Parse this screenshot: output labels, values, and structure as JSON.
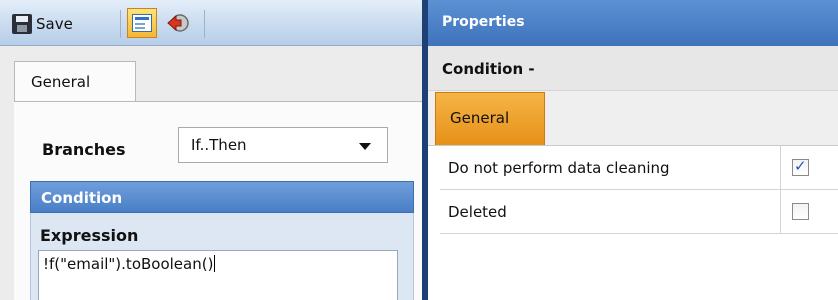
{
  "toolbar": {
    "save_label": "Save",
    "icons": [
      "floppy-disk-icon",
      "properties-icon",
      "back-arrow-icon"
    ]
  },
  "left": {
    "tab_label": "General",
    "branches_label": "Branches",
    "branches_value": "If..Then",
    "condition_header": "Condition",
    "expression_label": "Expression",
    "expression_value": "!f(\"email\").toBoolean()"
  },
  "right": {
    "panel_title": "Properties",
    "object_title": "Condition -",
    "tab_label": "General",
    "rows": [
      {
        "label": "Do not perform data cleaning",
        "checked": true
      },
      {
        "label": "Deleted",
        "checked": false
      }
    ]
  },
  "colors": {
    "header_blue": "#4a7fc6",
    "active_tab_orange": "#e69118",
    "pane_border": "#1f3f77"
  }
}
